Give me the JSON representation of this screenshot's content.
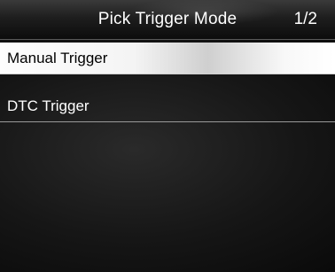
{
  "header": {
    "title": "Pick Trigger Mode",
    "page_indicator": "1/2"
  },
  "menu": {
    "items": [
      {
        "label": "Manual Trigger",
        "selected": true
      },
      {
        "label": "DTC Trigger",
        "selected": false
      }
    ]
  },
  "colors": {
    "background": "#161616",
    "selected_bg": "#f4f4f4",
    "selected_text": "#000000",
    "text": "#ffffff"
  }
}
